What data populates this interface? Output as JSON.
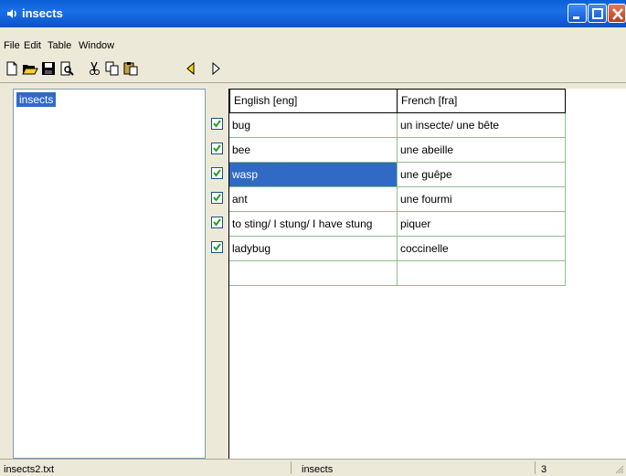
{
  "window": {
    "title": "insects"
  },
  "menu": [
    "File",
    "Edit",
    "Table",
    "Window"
  ],
  "toolbar_icons": [
    "new-file-icon",
    "open-folder-icon",
    "save-icon",
    "print-preview-icon",
    "cut-icon",
    "copy-icon",
    "paste-icon",
    "play-back-icon",
    "play-forward-icon"
  ],
  "tree": {
    "items": [
      "insects"
    ]
  },
  "table": {
    "headers": [
      "English  [eng]",
      "French  [fra]"
    ],
    "rows": [
      {
        "english": "bug",
        "french": "un insecte/ une bête",
        "checked": true
      },
      {
        "english": "bee",
        "french": "une abeille",
        "checked": true
      },
      {
        "english": "wasp",
        "french": "une guêpe",
        "checked": true,
        "selected": true
      },
      {
        "english": "ant",
        "french": "une fourmi",
        "checked": true
      },
      {
        "english": "to sting/ I stung/ I have stung",
        "french": "piquer",
        "checked": true
      },
      {
        "english": "ladybug",
        "french": "coccinelle",
        "checked": true
      },
      {
        "english": "",
        "french": "",
        "checked": false
      }
    ]
  },
  "status": {
    "file": "insects2.txt",
    "table": "insects",
    "count": "3"
  },
  "colors": {
    "selection": "#316ac5",
    "grid": "#8fbf8f",
    "titlebar": "#0a5fd8"
  }
}
